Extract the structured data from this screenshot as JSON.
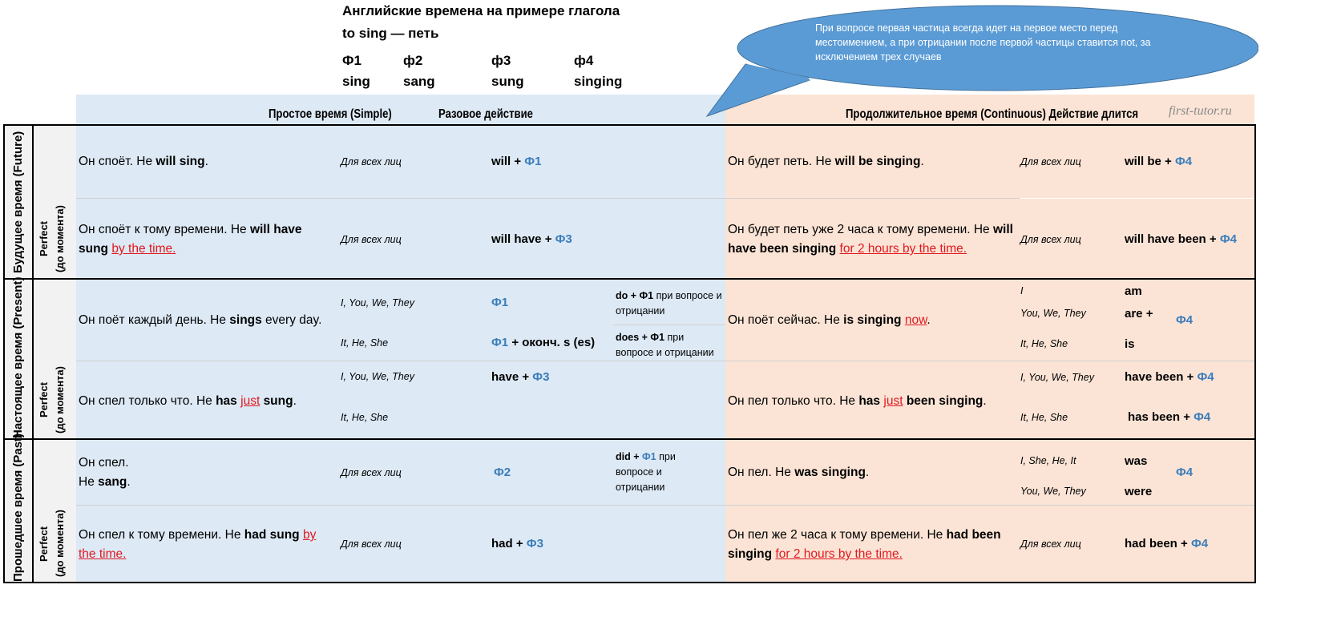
{
  "title": {
    "line1": "Английские времена на примере глагола",
    "line2": "to sing — петь"
  },
  "forms": [
    {
      "label": "Ф1",
      "value": "sing"
    },
    {
      "label": "ф2",
      "value": "sang"
    },
    {
      "label": "ф3",
      "value": "sung"
    },
    {
      "label": "ф4",
      "value": "singing"
    }
  ],
  "callout": "При вопросе первая частица всегда идет на первое место перед местоимением, а при отрицании после первой частицы ставится not, за исключением трех случаев",
  "header": {
    "simple": "Простое время (Simple)",
    "simple_desc": "Разовое действие",
    "continuous": "Продолжительное время (Continuous) Действие длится",
    "watermark": "first-tutor.ru"
  },
  "tenses": {
    "future": "Будущее время (Future)",
    "present": "Настоящее время (Present)",
    "past": "Прошедшее время (Past)",
    "perfect": "Perfect",
    "perfect_sub": "(до момента)"
  },
  "all_persons": "Для всех лиц",
  "rows": {
    "fs": {
      "s": [
        [
          "Он споёт. Не ",
          "n"
        ],
        [
          "will sing",
          "b"
        ],
        [
          ".",
          "n"
        ]
      ],
      "sf": [
        [
          "will + ",
          "b"
        ],
        [
          "Ф1",
          "c"
        ]
      ],
      "c": [
        [
          "Он будет петь. Не ",
          "n"
        ],
        [
          "will be singing",
          "b"
        ],
        [
          ".",
          "n"
        ]
      ],
      "cf": [
        [
          "will be + ",
          "b"
        ],
        [
          "Ф4",
          "c"
        ]
      ]
    },
    "fp": {
      "s": [
        [
          "Он споёт к тому времени. Не ",
          "n"
        ],
        [
          "will have sung",
          "b"
        ],
        [
          " ",
          "n"
        ],
        [
          "by the time.",
          "r"
        ]
      ],
      "sf": [
        [
          "will have + ",
          "b"
        ],
        [
          "Ф3",
          "c"
        ]
      ],
      "c": [
        [
          "Он будет петь уже 2 часа к тому времени. Не ",
          "n"
        ],
        [
          "will have been singing",
          "b"
        ],
        [
          " ",
          "n"
        ],
        [
          "for 2 hours by the time.",
          "r"
        ]
      ],
      "cf": [
        [
          "will have been + ",
          "b"
        ],
        [
          "Ф4",
          "c"
        ]
      ]
    },
    "ps": {
      "s": [
        [
          "Он поёт каждый день. Не ",
          "n"
        ],
        [
          "sings",
          "b"
        ],
        [
          " every day.",
          "n"
        ]
      ],
      "p1": "I, You, We, They",
      "p2": "It, He, She",
      "f1": [
        [
          "Ф1",
          "c"
        ]
      ],
      "f2": [
        [
          "Ф1",
          "c"
        ],
        [
          " + оконч. s (es)",
          "b"
        ]
      ],
      "n1": [
        [
          "do + Ф1",
          "b"
        ],
        [
          " при вопросе и отрицании",
          "n"
        ]
      ],
      "n2": [
        [
          "does + Ф1",
          "b"
        ],
        [
          " при вопросе и отрицании",
          "n"
        ]
      ],
      "c": [
        [
          "Он поёт сейчас. Не ",
          "n"
        ],
        [
          "is singing",
          "b"
        ],
        [
          " ",
          "n"
        ],
        [
          "now",
          "r"
        ],
        [
          ".",
          "n"
        ]
      ],
      "cp1": "I",
      "cp2": "You, We,  They",
      "cp3": "It, He, She",
      "cv1": "am",
      "cv2": "are +",
      "cv3": "is",
      "cf": [
        [
          "Ф4",
          "c"
        ]
      ]
    },
    "pp": {
      "s": [
        [
          "Он спел только что. Не ",
          "n"
        ],
        [
          "has",
          "b"
        ],
        [
          " ",
          "n"
        ],
        [
          "just",
          "r"
        ],
        [
          " ",
          "n"
        ],
        [
          "sung",
          "b"
        ],
        [
          ".",
          "n"
        ]
      ],
      "p1": "I, You, We,  They",
      "p2": "It, He, She",
      "f1": [
        [
          "have + ",
          "b"
        ],
        [
          "Ф3",
          "c"
        ]
      ],
      "c": [
        [
          "Он пел только что. Не ",
          "n"
        ],
        [
          "has",
          "b"
        ],
        [
          " ",
          "n"
        ],
        [
          "just",
          "r"
        ],
        [
          " ",
          "n"
        ],
        [
          "been singing",
          "b"
        ],
        [
          ".",
          "n"
        ]
      ],
      "cp1": "I, You, We,  They",
      "cp2": "It, He, She",
      "cf1": [
        [
          "have been + ",
          "b"
        ],
        [
          "Ф4",
          "c"
        ]
      ],
      "cf2": [
        [
          "has been  + ",
          "b"
        ],
        [
          "Ф4",
          "c"
        ]
      ]
    },
    "pas": {
      "s": [
        [
          "Он спел.",
          "n"
        ],
        [
          "\n",
          "n"
        ],
        [
          "Не ",
          "n"
        ],
        [
          "sang",
          "b"
        ],
        [
          ".",
          "n"
        ]
      ],
      "sf": [
        [
          "Ф2",
          "c"
        ]
      ],
      "n1": [
        [
          "did + ",
          "b"
        ],
        [
          "Ф1",
          "c"
        ],
        [
          "  при вопросе и отрицании",
          "n"
        ]
      ],
      "c": [
        [
          "Он пел. Не ",
          "n"
        ],
        [
          "was singing",
          "b"
        ],
        [
          ".",
          "n"
        ]
      ],
      "cp1": "I, She, He, It",
      "cp2": "You, We, They",
      "cv1": "was",
      "cv2": "were",
      "cf": [
        [
          "Ф4",
          "c"
        ]
      ]
    },
    "pap": {
      "s": [
        [
          "Он спел к тому времени. Не ",
          "n"
        ],
        [
          "had sung",
          "b"
        ],
        [
          " ",
          "n"
        ],
        [
          "by the time.",
          "r"
        ]
      ],
      "sf": [
        [
          "had + ",
          "b"
        ],
        [
          "Ф3",
          "c"
        ]
      ],
      "c": [
        [
          "Он пел же 2 часа к тому времени. Не ",
          "n"
        ],
        [
          "had been singing",
          "b"
        ],
        [
          " ",
          "n"
        ],
        [
          "for 2 hours by the time.",
          "r"
        ]
      ],
      "cf": [
        [
          "had been + ",
          "b"
        ],
        [
          "Ф4",
          "c"
        ]
      ]
    }
  },
  "colors": {
    "simple_bg": "#dde9f5",
    "continuous_bg": "#fbe4d6",
    "callout": "#5b9bd5",
    "red": "#e0191f",
    "form_blue": "#3a7dbb"
  }
}
